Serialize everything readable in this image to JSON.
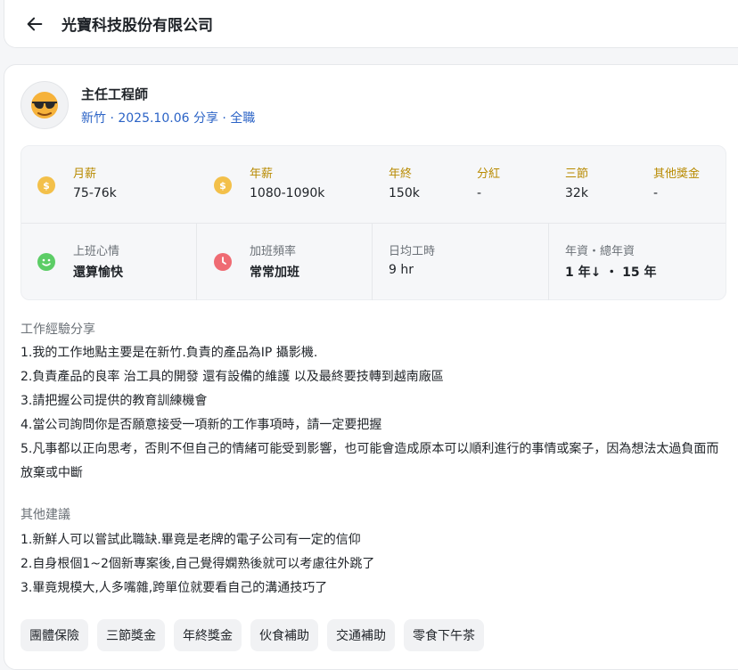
{
  "header": {
    "company": "光寶科技股份有限公司"
  },
  "review": {
    "title": "主任工程師",
    "meta": "新竹 · 2025.10.06 分享 · 全職",
    "stats": {
      "monthly_label": "月薪",
      "monthly_value": "75-76k",
      "annual_label": "年薪",
      "annual_value": "1080-1090k",
      "bonus_label": "年終",
      "bonus_value": "150k",
      "dividend_label": "分紅",
      "dividend_value": "-",
      "festival_label": "三節",
      "festival_value": "32k",
      "other_label": "其他獎金",
      "other_value": "-",
      "mood_label": "上班心情",
      "mood_value": "還算愉快",
      "overtime_label": "加班頻率",
      "overtime_value": "常常加班",
      "hours_label": "日均工時",
      "hours_value": "9 hr",
      "tenure_label": "年資・總年資",
      "tenure_value": "1 年↓ ・ 15 年"
    },
    "experience_title": "工作經驗分享",
    "experience_lines": [
      "1.我的工作地點主要是在新竹.負責的產品為IP 攝影機.",
      "2.負責產品的良率 治工具的開發 還有設備的維護 以及最終要技轉到越南廠區",
      "3.請把握公司提供的教育訓練機會",
      "4.當公司詢問你是否願意接受一項新的工作事項時，請一定要把握",
      "5.凡事都以正向思考，否則不但自己的情緒可能受到影響，也可能會造成原本可以順利進行的事情或案子，因為想法太過負面而放棄或中斷"
    ],
    "advice_title": "其他建議",
    "advice_lines": [
      "1.新鮮人可以嘗試此職缺.畢竟是老牌的電子公司有一定的信仰",
      "2.自身根個1~2個新專案後,自己覺得嫻熟後就可以考慮往外跳了",
      "3.畢竟規模大,人多嘴雜,跨單位就要看自己的溝通技巧了"
    ],
    "tags": [
      "團體保險",
      "三節獎金",
      "年終獎金",
      "伙食補助",
      "交通補助",
      "零食下午茶"
    ]
  },
  "colors": {
    "accent_blue": "#2b63c6",
    "gold_label": "#b88a00",
    "coin": "#f3c04a"
  }
}
